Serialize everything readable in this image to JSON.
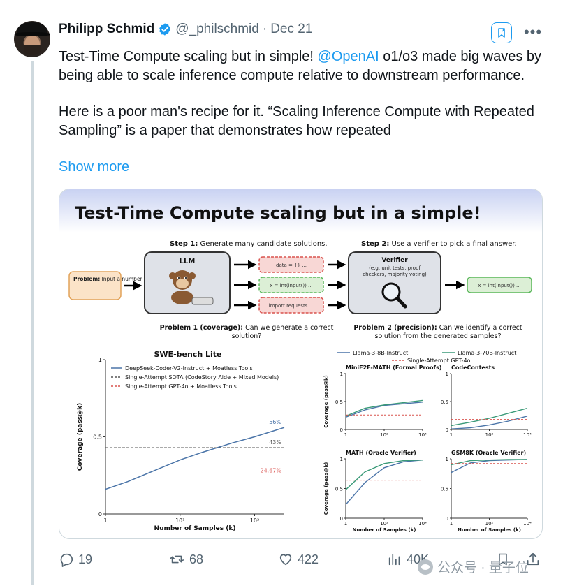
{
  "tweet": {
    "author_name": "Philipp Schmid",
    "handle": "@_philschmid",
    "separator": "·",
    "date": "Dec 21",
    "text_line1_before": "Test-Time Compute scaling but in simple! ",
    "mention": "@OpenAI",
    "text_line1_after": "  o1/o3 made big waves by being able to scale inference compute relative to downstream performance.",
    "paragraph2": "Here is a poor man's recipe for it. “Scaling Inference Compute with Repeated Sampling” is a paper that demonstrates how repeated",
    "show_more": "Show more"
  },
  "figure": {
    "title": "Test-Time Compute scaling but in a simple!",
    "step1_bold": "Step 1:",
    "step1_text": " Generate many candidate solutions.",
    "step2_bold": "Step 2:",
    "step2_text": " Use a verifier to pick a final answer.",
    "problem_bold": "Problem:",
    "problem_text": " Input a number from stdin and ...",
    "llm_label": "LLM",
    "candidates": [
      "data = {} ...",
      "x = int(input()) ...",
      "import requests ..."
    ],
    "verifier_title": "Verifier",
    "verifier_desc1": "(e.g. unit tests, proof",
    "verifier_desc2": "checkers, majority voting)",
    "final_answer": "x = int(input()) ...",
    "problem1_bold": "Problem 1 (coverage):",
    "problem1_text1": " Can we generate a correct",
    "problem1_text2": "solution?",
    "problem2_bold": "Problem 2 (precision):",
    "problem2_text1": " Can we identify a correct",
    "problem2_text2": "solution from the generated samples?"
  },
  "chart_data": [
    {
      "type": "line",
      "title": "SWE-bench Lite",
      "xlabel": "Number of Samples (k)",
      "ylabel": "Coverage (pass@k)",
      "xscale": "log",
      "xlim": [
        1,
        250
      ],
      "ylim": [
        0,
        1
      ],
      "xticks": [
        "1",
        "10¹",
        "10²"
      ],
      "yticks": [
        "0",
        "0.5",
        "1"
      ],
      "series": [
        {
          "name": "DeepSeek-Coder-V2-Instruct + Moatless Tools",
          "color": "#4a74a8",
          "style": "solid",
          "x": [
            1,
            2,
            5,
            10,
            20,
            50,
            100,
            250
          ],
          "y": [
            0.16,
            0.21,
            0.29,
            0.35,
            0.4,
            0.46,
            0.5,
            0.56
          ]
        },
        {
          "name": "Single-Attempt SOTA (CodeStory Aide + Mixed Models)",
          "color": "#555555",
          "style": "dashed",
          "x": [
            1,
            250
          ],
          "y": [
            0.43,
            0.43
          ]
        },
        {
          "name": "Single-Attempt GPT-4o + Moatless Tools",
          "color": "#d9534f",
          "style": "dashed",
          "x": [
            1,
            250
          ],
          "y": [
            0.2467,
            0.2467
          ]
        }
      ],
      "annotations": [
        {
          "text": "56%",
          "x": 250,
          "y": 0.56,
          "color": "#4a74a8"
        },
        {
          "text": "43%",
          "x": 250,
          "y": 0.43,
          "color": "#555555"
        },
        {
          "text": "24.67%",
          "x": 250,
          "y": 0.2467,
          "color": "#d9534f"
        }
      ]
    },
    {
      "type": "line",
      "legend": [
        "Llama-3-8B-Instruct",
        "Llama-3-70B-Instruct",
        "Single-Attempt GPT-4o"
      ],
      "legend_colors": [
        "#4a74a8",
        "#3a9a78",
        "#d9534f"
      ],
      "panels": [
        {
          "title": "MiniF2F-MATH (Formal Proofs)",
          "ylabel": "Coverage (pass@k)",
          "xlabel": "",
          "ylim": [
            0,
            1
          ],
          "yticks": [
            "0",
            "0.5",
            "1"
          ],
          "xticks": [
            "1",
            "10²",
            "10⁴"
          ],
          "xscale": "log",
          "series": [
            {
              "name": "Llama-3-8B-Instruct",
              "x": [
                1,
                10,
                100,
                1000,
                10000
              ],
              "y": [
                0.22,
                0.35,
                0.43,
                0.46,
                0.49
              ]
            },
            {
              "name": "Llama-3-70B-Instruct",
              "x": [
                1,
                10,
                100,
                1000,
                10000
              ],
              "y": [
                0.24,
                0.38,
                0.44,
                0.48,
                0.52
              ]
            },
            {
              "name": "Single-Attempt GPT-4o",
              "x": [
                1,
                10000
              ],
              "y": [
                0.26,
                0.26
              ]
            }
          ]
        },
        {
          "title": "CodeContests",
          "ylabel": "",
          "xlabel": "",
          "ylim": [
            0,
            1
          ],
          "yticks": [
            "0",
            "0.5",
            "1"
          ],
          "xticks": [
            "1",
            "10²",
            "10⁴"
          ],
          "xscale": "log",
          "series": [
            {
              "name": "Llama-3-8B-Instruct",
              "x": [
                1,
                10,
                100,
                1000,
                10000
              ],
              "y": [
                0.01,
                0.03,
                0.08,
                0.15,
                0.24
              ]
            },
            {
              "name": "Llama-3-70B-Instruct",
              "x": [
                1,
                10,
                100,
                1000,
                10000
              ],
              "y": [
                0.07,
                0.13,
                0.2,
                0.29,
                0.38
              ]
            },
            {
              "name": "Single-Attempt GPT-4o",
              "x": [
                1,
                10000
              ],
              "y": [
                0.18,
                0.18
              ]
            }
          ]
        },
        {
          "title": "MATH (Oracle Verifier)",
          "ylabel": "Coverage (pass@k)",
          "xlabel": "Number of Samples (k)",
          "ylim": [
            0,
            1
          ],
          "yticks": [
            "0",
            "0.5",
            "1"
          ],
          "xticks": [
            "1",
            "10²",
            "10⁴"
          ],
          "xscale": "log",
          "series": [
            {
              "name": "Llama-3-8B-Instruct",
              "x": [
                1,
                10,
                100,
                1000,
                10000
              ],
              "y": [
                0.23,
                0.6,
                0.85,
                0.95,
                0.98
              ]
            },
            {
              "name": "Llama-3-70B-Instruct",
              "x": [
                1,
                10,
                100,
                1000,
                10000
              ],
              "y": [
                0.48,
                0.78,
                0.92,
                0.97,
                0.98
              ]
            },
            {
              "name": "Single-Attempt GPT-4o",
              "x": [
                1,
                10000
              ],
              "y": [
                0.64,
                0.64
              ]
            }
          ]
        },
        {
          "title": "GSM8K (Oracle Verifier)",
          "ylabel": "",
          "xlabel": "Number of Samples (k)",
          "ylim": [
            0,
            1
          ],
          "yticks": [
            "0",
            "0.5",
            "1"
          ],
          "xticks": [
            "1",
            "10²",
            "10⁴"
          ],
          "xscale": "log",
          "series": [
            {
              "name": "Llama-3-8B-Instruct",
              "x": [
                1,
                10,
                100,
                1000,
                10000
              ],
              "y": [
                0.77,
                0.93,
                0.97,
                0.98,
                0.99
              ]
            },
            {
              "name": "Llama-3-70B-Instruct",
              "x": [
                1,
                10,
                100,
                1000,
                10000
              ],
              "y": [
                0.9,
                0.97,
                0.98,
                0.99,
                0.99
              ]
            },
            {
              "name": "Single-Attempt GPT-4o",
              "x": [
                1,
                10000
              ],
              "y": [
                0.92,
                0.92
              ]
            }
          ]
        }
      ]
    }
  ],
  "actions": {
    "replies": "19",
    "reposts": "68",
    "likes": "422",
    "views": "40K"
  },
  "watermark": {
    "text": "公众号 · 量子位"
  },
  "colors": {
    "link": "#1d9bf0",
    "muted": "#536471",
    "verified": "#1d9bf0"
  }
}
